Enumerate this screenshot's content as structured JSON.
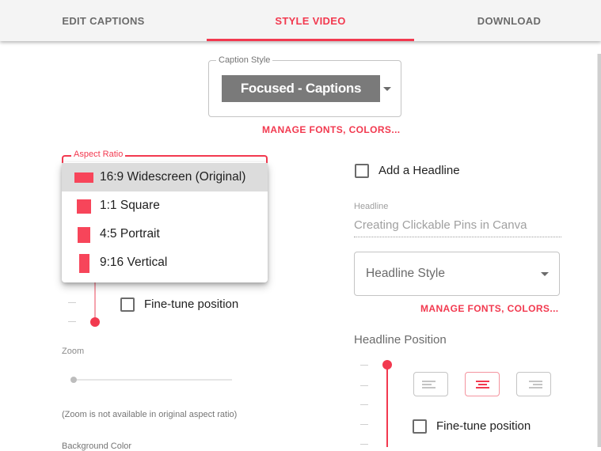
{
  "tabs": [
    {
      "label": "EDIT CAPTIONS",
      "active": false
    },
    {
      "label": "STYLE VIDEO",
      "active": true
    },
    {
      "label": "DOWNLOAD",
      "active": false
    }
  ],
  "caption_style": {
    "legend": "Caption Style",
    "selected": "Focused - Captions",
    "manage_link": "MANAGE FONTS, COLORS..."
  },
  "aspect_ratio": {
    "legend": "Aspect Ratio",
    "options": [
      {
        "label": "16:9 Widescreen (Original)",
        "selected": true
      },
      {
        "label": "1:1 Square",
        "selected": false
      },
      {
        "label": "4:5 Portrait",
        "selected": false
      },
      {
        "label": "9:16 Vertical",
        "selected": false
      }
    ]
  },
  "left_position": {
    "fine_tune_label": "Fine-tune position",
    "fine_tune_checked": false
  },
  "zoom": {
    "label": "Zoom",
    "value": 0,
    "note": "(Zoom is not available in original aspect ratio)"
  },
  "background_color": {
    "label": "Background Color"
  },
  "headline": {
    "add_label": "Add a Headline",
    "add_checked": false,
    "field_label": "Headline",
    "field_value": "Creating Clickable Pins in Canva",
    "style_placeholder": "Headline Style",
    "manage_link": "MANAGE FONTS, COLORS...",
    "position_label": "Headline Position",
    "alignments": [
      {
        "name": "left",
        "active": false
      },
      {
        "name": "center",
        "active": true
      },
      {
        "name": "right",
        "active": false
      }
    ],
    "fine_tune_label": "Fine-tune position",
    "fine_tune_checked": false
  },
  "colors": {
    "accent": "#f2394f",
    "tab_bg": "#f4f4f4",
    "caption_chip_bg": "#7a7a7a"
  }
}
